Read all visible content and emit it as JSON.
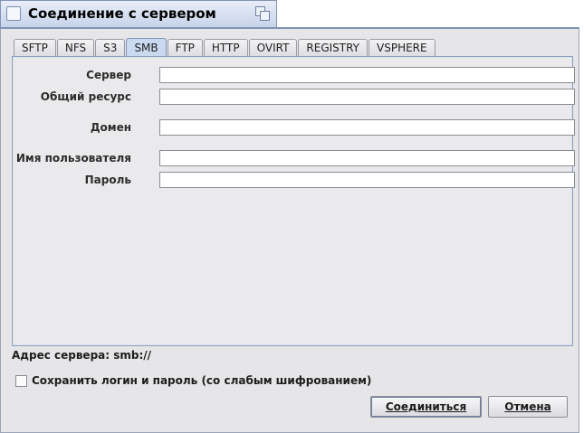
{
  "window": {
    "title": "Соединение с сервером"
  },
  "tabs": [
    {
      "label": "SFTP",
      "active": false
    },
    {
      "label": "NFS",
      "active": false
    },
    {
      "label": "S3",
      "active": false
    },
    {
      "label": "SMB",
      "active": true
    },
    {
      "label": "FTP",
      "active": false
    },
    {
      "label": "HTTP",
      "active": false
    },
    {
      "label": "OVIRT",
      "active": false
    },
    {
      "label": "REGISTRY",
      "active": false
    },
    {
      "label": "VSPHERE",
      "active": false
    }
  ],
  "form": {
    "server_label": "Сервер",
    "server_value": "",
    "share_label": "Общий ресурс",
    "share_value": "",
    "domain_label": "Домен",
    "domain_value": "",
    "user_label": "Имя пользователя",
    "user_value": "",
    "password_label": "Пароль",
    "password_value": ""
  },
  "address": {
    "text": "Адрес сервера:  smb://"
  },
  "save_credentials": {
    "label": "Сохранить логин и пароль (со слабым шифрованием)",
    "checked": false
  },
  "buttons": {
    "connect": "Соединиться",
    "cancel": "Отмена"
  }
}
